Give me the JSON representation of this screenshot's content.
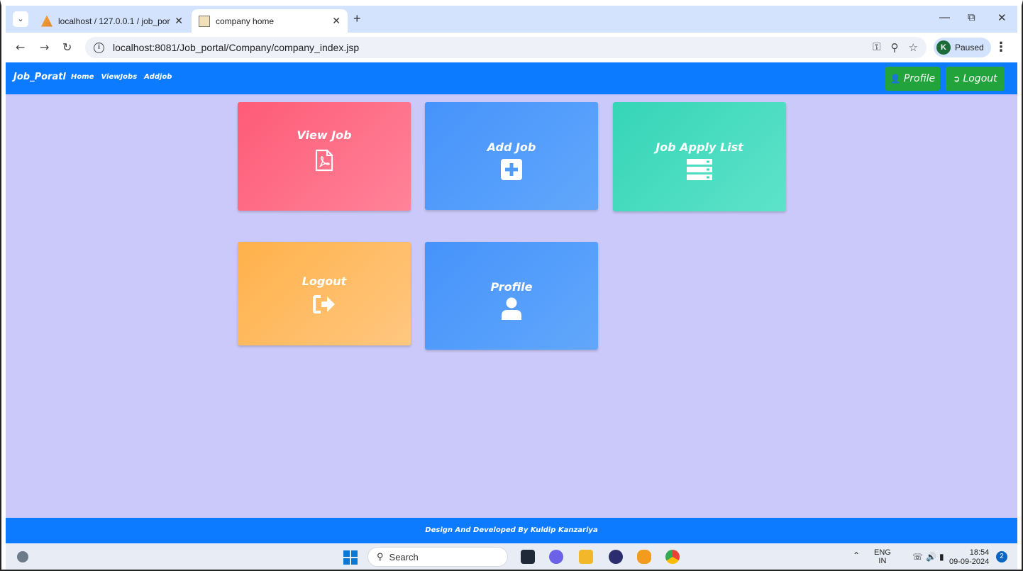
{
  "browser": {
    "tabs": [
      {
        "title": "localhost / 127.0.0.1 / job_porta",
        "active": false
      },
      {
        "title": "company home",
        "active": true
      }
    ],
    "address": "localhost:8081/Job_portal/Company/company_index.jsp",
    "profile_initial": "K",
    "profile_status": "Paused"
  },
  "navbar": {
    "brand": "Job_Poratl",
    "links": [
      "Home",
      "ViewJobs",
      "Addjob"
    ],
    "profile_button": "Profile",
    "logout_button": "Logout"
  },
  "cards": [
    {
      "title": "View Job",
      "icon": "pdf-file-icon",
      "color": "#fe5b77"
    },
    {
      "title": "Add Job",
      "icon": "plus-square-icon",
      "color": "#4593fb"
    },
    {
      "title": "Job Apply List",
      "icon": "server-list-icon",
      "color": "#35d5b8"
    },
    {
      "title": "Logout",
      "icon": "sign-out-icon",
      "color": "#ffb14a"
    },
    {
      "title": "Profile",
      "icon": "user-icon",
      "color": "#4593fb"
    }
  ],
  "footer": {
    "text": "Design And Developed By Kuldip Kanzariya"
  },
  "taskbar": {
    "search_placeholder": "Search",
    "lang_top": "ENG",
    "lang_bottom": "IN",
    "time": "18:54",
    "date": "09-09-2024",
    "notification_count": "2"
  },
  "colors": {
    "navbar": "#0d7bff",
    "background": "#cbc9f9",
    "green_button": "#23a33b"
  }
}
